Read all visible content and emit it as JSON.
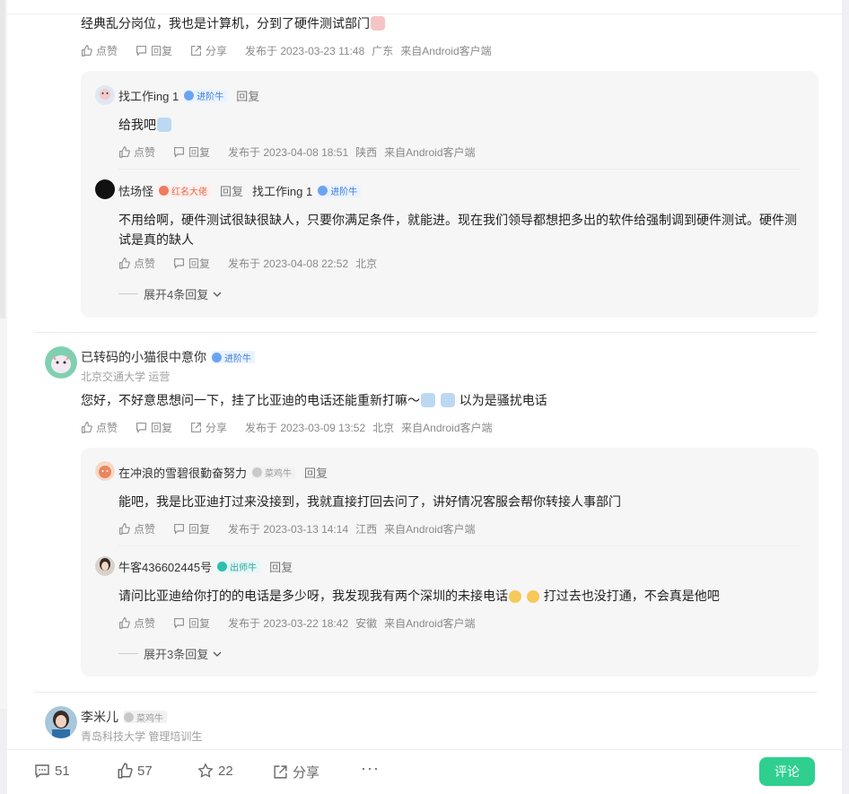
{
  "c1": {
    "text": "经典乱分岗位，我也是计算机，分到了硬件测试部门",
    "like": "点赞",
    "reply": "回复",
    "share": "分享",
    "time": "发布于 2023-03-23 11:48",
    "loc": "广东",
    "client": "来自Android客户端",
    "replies": [
      {
        "name": "找工作ing 1",
        "badge": "进阶牛",
        "reply_label": "回复",
        "text": "给我吧",
        "like": "点赞",
        "reply": "回复",
        "time": "发布于 2023-04-08 18:51",
        "loc": "陕西",
        "client": "来自Android客户端"
      },
      {
        "name": "怯场怪",
        "badge": "红名大佬",
        "reply_label": "回复",
        "reply_to": "找工作ing 1",
        "reply_to_badge": "进阶牛",
        "text_line1": "不用给啊，硬件测试很缺很缺人，只要你满足条件，就能进。现在我们领导都想把多出的软件给强制调到硬件测试。硬件测",
        "text_line2": "试是真的缺人",
        "like": "点赞",
        "reply": "回复",
        "time": "发布于 2023-04-08 22:52",
        "loc": "北京",
        "client": ""
      }
    ],
    "expand": "展开4条回复"
  },
  "c2": {
    "name": "已转码的小猫很中意你",
    "badge": "进阶牛",
    "sub": "北京交通大学 运营",
    "text_a": "您好，不好意思想问一下，挂了比亚迪的电话还能重新打嘛～",
    "text_b": "以为是骚扰电话",
    "like": "点赞",
    "reply": "回复",
    "share": "分享",
    "time": "发布于 2023-03-09 13:52",
    "loc": "北京",
    "client": "来自Android客户端",
    "replies": [
      {
        "name": "在冲浪的雪碧很勤奋努力",
        "badge": "菜鸡牛",
        "reply_label": "回复",
        "text": "能吧，我是比亚迪打过来没接到，我就直接打回去问了，讲好情况客服会帮你转接人事部门",
        "like": "点赞",
        "reply": "回复",
        "time": "发布于 2023-03-13 14:14",
        "loc": "江西",
        "client": "来自Android客户端"
      },
      {
        "name": "牛客436602445号",
        "badge": "出师牛",
        "reply_label": "回复",
        "text_a": "请问比亚迪给你打的的电话是多少呀，我发现我有两个深圳的未接电话",
        "text_b": "打过去也没打通，不会真是他吧",
        "like": "点赞",
        "reply": "回复",
        "time": "发布于 2023-03-22 18:42",
        "loc": "安徽",
        "client": "来自Android客户端"
      }
    ],
    "expand": "展开3条回复"
  },
  "c3": {
    "name": "李米儿",
    "badge": "菜鸡牛",
    "sub": "青岛科技大学 管理培训生"
  },
  "bottom": {
    "comments": "51",
    "likes": "57",
    "stars": "22",
    "share": "分享",
    "more": "···",
    "comment_btn": "评论"
  },
  "colors": {
    "accent": "#2fcf8f",
    "badge_blue": "#3d7bd8",
    "badge_red": "#e9674c",
    "badge_teal": "#26a69a"
  }
}
